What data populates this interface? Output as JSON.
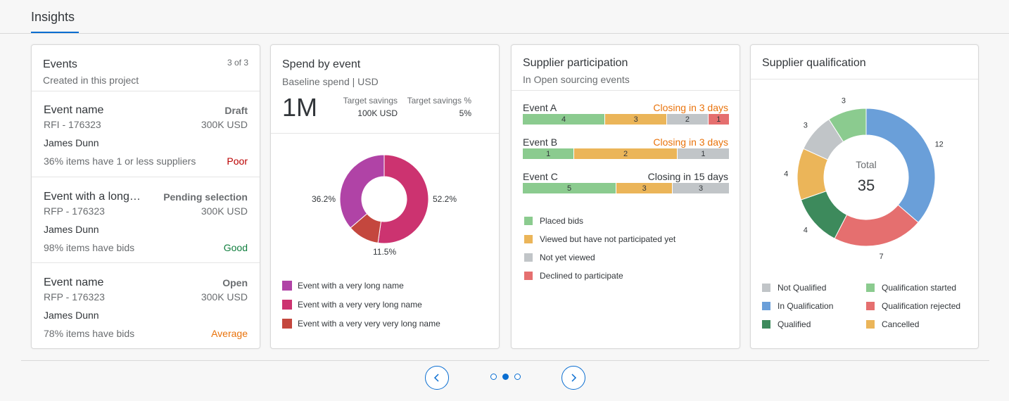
{
  "header": {
    "tab_label": "Insights"
  },
  "events_card": {
    "title": "Events",
    "subtitle": "Created in this project",
    "counter": "3 of 3",
    "items": [
      {
        "name": "Event name",
        "status": "Draft",
        "id": "RFI - 176323",
        "amount": "300K USD",
        "person": "James Dunn",
        "note": "36% items have 1 or less suppliers",
        "rating": "Poor",
        "rating_color": "#bb0000"
      },
      {
        "name": "Event with a long…",
        "status": "Pending selection",
        "id": "RFP - 176323",
        "amount": "300K USD",
        "person": "James Dunn",
        "note": "98% items have bids",
        "rating": "Good",
        "rating_color": "#107e3e"
      },
      {
        "name": "Event name",
        "status": "Open",
        "id": "RFP - 176323",
        "amount": "300K USD",
        "person": "James Dunn",
        "note": "78% items have bids",
        "rating": "Average",
        "rating_color": "#e9730c"
      }
    ]
  },
  "spend_card": {
    "title": "Spend by event",
    "subtitle": "Baseline spend | USD",
    "big_value": "1M",
    "kpis": [
      {
        "label": "Target savings",
        "value": "100K USD"
      },
      {
        "label": "Target savings %",
        "value": "5%"
      }
    ]
  },
  "participation_card": {
    "title": "Supplier participation",
    "subtitle": "In Open sourcing events",
    "legend": [
      {
        "label": "Placed bids",
        "color": "#8bcb8f"
      },
      {
        "label": "Viewed but have not participated yet",
        "color": "#ebb559"
      },
      {
        "label": "Not yet viewed",
        "color": "#c1c5c8"
      },
      {
        "label": "Declined to participate",
        "color": "#e56f6f"
      }
    ]
  },
  "qualification_card": {
    "title": "Supplier qualification",
    "center_label": "Total",
    "center_value": "35"
  },
  "chart_data": [
    {
      "type": "pie",
      "title": "Spend by event",
      "series": [
        {
          "name": "Event with a very long name",
          "value": 36.2,
          "label": "36.2%",
          "color": "#b043a6"
        },
        {
          "name": "Event with a very very long name",
          "value": 52.2,
          "label": "52.2%",
          "color": "#cc3370"
        },
        {
          "name": "Event with a very very very long name",
          "value": 11.5,
          "label": "11.5%",
          "color": "#c4473e"
        }
      ]
    },
    {
      "type": "bar",
      "title": "Supplier participation",
      "categories": [
        "Event A",
        "Event B",
        "Event C"
      ],
      "closing": [
        {
          "text": "Closing in 3 days",
          "color": "#e9730c"
        },
        {
          "text": "Closing in 3 days",
          "color": "#e9730c"
        },
        {
          "text": "Closing in 15 days",
          "color": "#32363a"
        }
      ],
      "series": [
        {
          "name": "Placed bids",
          "values": [
            4,
            1,
            5
          ],
          "color": "#8bcb8f"
        },
        {
          "name": "Viewed but have not participated yet",
          "values": [
            3,
            2,
            3
          ],
          "color": "#ebb559"
        },
        {
          "name": "Not yet viewed",
          "values": [
            2,
            1,
            3
          ],
          "color": "#c1c5c8"
        },
        {
          "name": "Declined to participate",
          "values": [
            1,
            0,
            0
          ],
          "color": "#e56f6f"
        }
      ]
    },
    {
      "type": "pie",
      "title": "Supplier qualification",
      "series": [
        {
          "name": "In Qualification",
          "value": 12,
          "color": "#6a9fd9"
        },
        {
          "name": "Qualification rejected",
          "value": 7,
          "color": "#e56f6f"
        },
        {
          "name": "Qualified",
          "value": 4,
          "color": "#3d8a5c"
        },
        {
          "name": "Cancelled",
          "value": 4,
          "color": "#ebb559"
        },
        {
          "name": "Not Qualified",
          "value": 3,
          "color": "#c1c5c8"
        },
        {
          "name": "Qualification started",
          "value": 3,
          "color": "#8bcb8f"
        }
      ],
      "legend_order": [
        "Not Qualified",
        "Qualification started",
        "In Qualification",
        "Qualification rejected",
        "Qualified",
        "Cancelled"
      ]
    }
  ]
}
